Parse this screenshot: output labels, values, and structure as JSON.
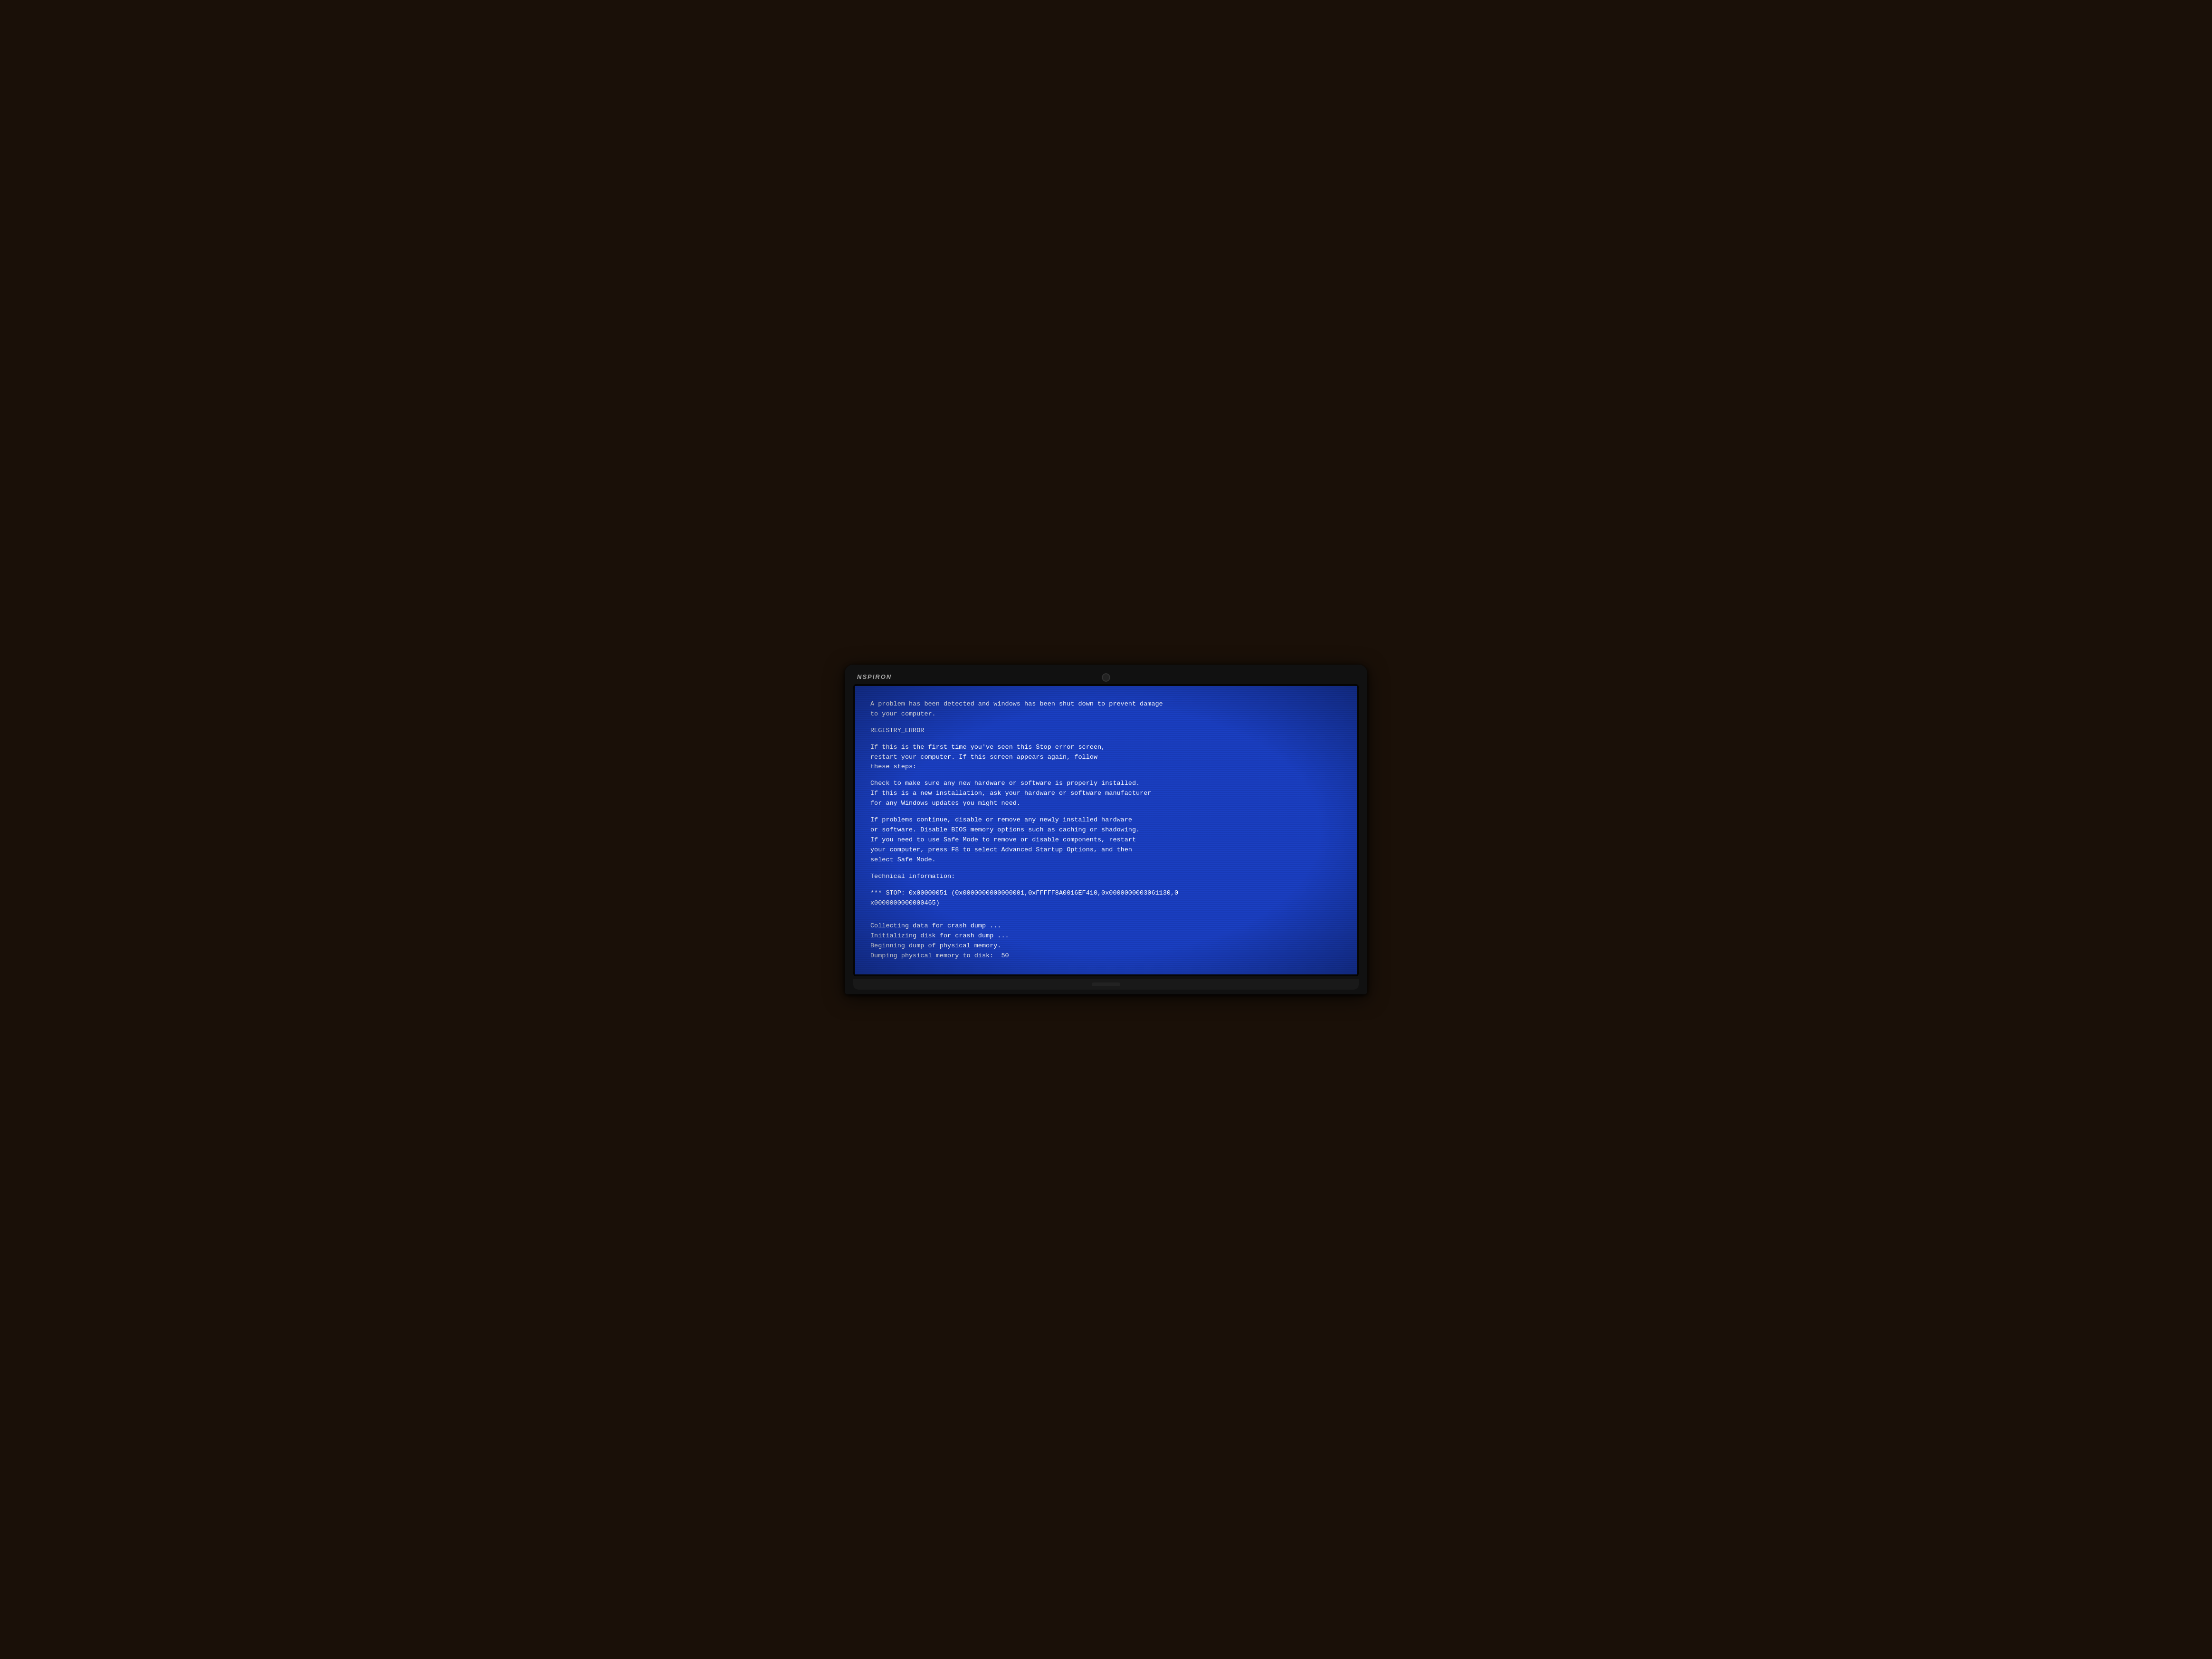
{
  "laptop": {
    "brand": "NSPIRON",
    "webcam_label": "webcam"
  },
  "bsod": {
    "line1": "A problem has been detected and windows has been shut down to prevent damage",
    "line2": "to your computer.",
    "spacer1": "",
    "error_code": "REGISTRY_ERROR",
    "spacer2": "",
    "line3": "If this is the first time you've seen this Stop error screen,",
    "line4": "restart your computer. If this screen appears again, follow",
    "line5": "these steps:",
    "spacer3": "",
    "line6": "Check to make sure any new hardware or software is properly installed.",
    "line7": "If this is a new installation, ask your hardware or software manufacturer",
    "line8": "for any Windows updates you might need.",
    "spacer4": "",
    "line9": "If problems continue, disable or remove any newly installed hardware",
    "line10": "or software. Disable BIOS memory options such as caching or shadowing.",
    "line11": "If you need to use Safe Mode to remove or disable components, restart",
    "line12": "your computer, press F8 to select Advanced Startup Options, and then",
    "line13": "select Safe Mode.",
    "spacer5": "",
    "line14": "Technical information:",
    "spacer6": "",
    "line15": "*** STOP: 0x00000051 (0x0000000000000001,0xFFFFF8A0016EF410,0x0000000003061130,0",
    "line16": "x0000000000000465)",
    "spacer7": "",
    "spacer8": "",
    "line17": "Collecting data for crash dump ...",
    "line18": "Initializing disk for crash dump ...",
    "line19": "Beginning dump of physical memory.",
    "line20": "Dumping physical memory to disk:  50"
  }
}
